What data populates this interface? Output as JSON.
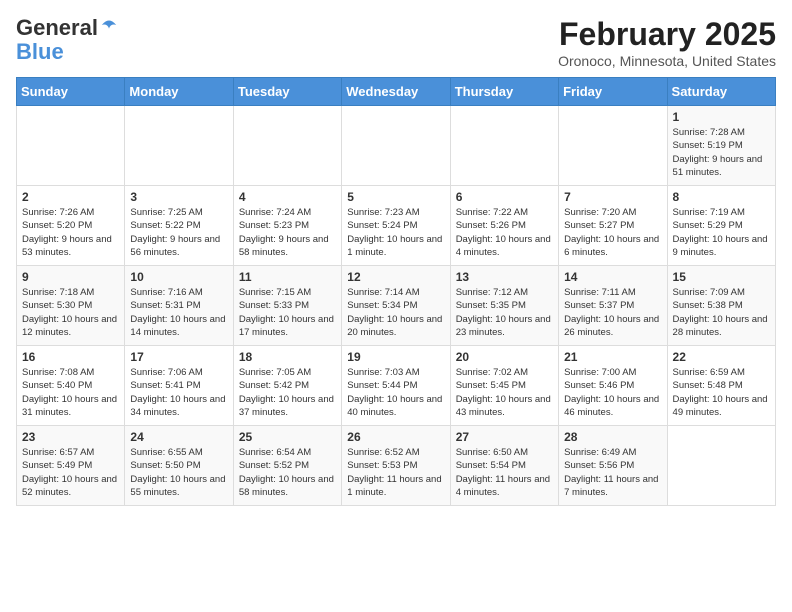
{
  "logo": {
    "line1": "General",
    "line2": "Blue"
  },
  "title": "February 2025",
  "subtitle": "Oronoco, Minnesota, United States",
  "weekdays": [
    "Sunday",
    "Monday",
    "Tuesday",
    "Wednesday",
    "Thursday",
    "Friday",
    "Saturday"
  ],
  "weeks": [
    [
      {
        "day": "",
        "info": ""
      },
      {
        "day": "",
        "info": ""
      },
      {
        "day": "",
        "info": ""
      },
      {
        "day": "",
        "info": ""
      },
      {
        "day": "",
        "info": ""
      },
      {
        "day": "",
        "info": ""
      },
      {
        "day": "1",
        "info": "Sunrise: 7:28 AM\nSunset: 5:19 PM\nDaylight: 9 hours and 51 minutes."
      }
    ],
    [
      {
        "day": "2",
        "info": "Sunrise: 7:26 AM\nSunset: 5:20 PM\nDaylight: 9 hours and 53 minutes."
      },
      {
        "day": "3",
        "info": "Sunrise: 7:25 AM\nSunset: 5:22 PM\nDaylight: 9 hours and 56 minutes."
      },
      {
        "day": "4",
        "info": "Sunrise: 7:24 AM\nSunset: 5:23 PM\nDaylight: 9 hours and 58 minutes."
      },
      {
        "day": "5",
        "info": "Sunrise: 7:23 AM\nSunset: 5:24 PM\nDaylight: 10 hours and 1 minute."
      },
      {
        "day": "6",
        "info": "Sunrise: 7:22 AM\nSunset: 5:26 PM\nDaylight: 10 hours and 4 minutes."
      },
      {
        "day": "7",
        "info": "Sunrise: 7:20 AM\nSunset: 5:27 PM\nDaylight: 10 hours and 6 minutes."
      },
      {
        "day": "8",
        "info": "Sunrise: 7:19 AM\nSunset: 5:29 PM\nDaylight: 10 hours and 9 minutes."
      }
    ],
    [
      {
        "day": "9",
        "info": "Sunrise: 7:18 AM\nSunset: 5:30 PM\nDaylight: 10 hours and 12 minutes."
      },
      {
        "day": "10",
        "info": "Sunrise: 7:16 AM\nSunset: 5:31 PM\nDaylight: 10 hours and 14 minutes."
      },
      {
        "day": "11",
        "info": "Sunrise: 7:15 AM\nSunset: 5:33 PM\nDaylight: 10 hours and 17 minutes."
      },
      {
        "day": "12",
        "info": "Sunrise: 7:14 AM\nSunset: 5:34 PM\nDaylight: 10 hours and 20 minutes."
      },
      {
        "day": "13",
        "info": "Sunrise: 7:12 AM\nSunset: 5:35 PM\nDaylight: 10 hours and 23 minutes."
      },
      {
        "day": "14",
        "info": "Sunrise: 7:11 AM\nSunset: 5:37 PM\nDaylight: 10 hours and 26 minutes."
      },
      {
        "day": "15",
        "info": "Sunrise: 7:09 AM\nSunset: 5:38 PM\nDaylight: 10 hours and 28 minutes."
      }
    ],
    [
      {
        "day": "16",
        "info": "Sunrise: 7:08 AM\nSunset: 5:40 PM\nDaylight: 10 hours and 31 minutes."
      },
      {
        "day": "17",
        "info": "Sunrise: 7:06 AM\nSunset: 5:41 PM\nDaylight: 10 hours and 34 minutes."
      },
      {
        "day": "18",
        "info": "Sunrise: 7:05 AM\nSunset: 5:42 PM\nDaylight: 10 hours and 37 minutes."
      },
      {
        "day": "19",
        "info": "Sunrise: 7:03 AM\nSunset: 5:44 PM\nDaylight: 10 hours and 40 minutes."
      },
      {
        "day": "20",
        "info": "Sunrise: 7:02 AM\nSunset: 5:45 PM\nDaylight: 10 hours and 43 minutes."
      },
      {
        "day": "21",
        "info": "Sunrise: 7:00 AM\nSunset: 5:46 PM\nDaylight: 10 hours and 46 minutes."
      },
      {
        "day": "22",
        "info": "Sunrise: 6:59 AM\nSunset: 5:48 PM\nDaylight: 10 hours and 49 minutes."
      }
    ],
    [
      {
        "day": "23",
        "info": "Sunrise: 6:57 AM\nSunset: 5:49 PM\nDaylight: 10 hours and 52 minutes."
      },
      {
        "day": "24",
        "info": "Sunrise: 6:55 AM\nSunset: 5:50 PM\nDaylight: 10 hours and 55 minutes."
      },
      {
        "day": "25",
        "info": "Sunrise: 6:54 AM\nSunset: 5:52 PM\nDaylight: 10 hours and 58 minutes."
      },
      {
        "day": "26",
        "info": "Sunrise: 6:52 AM\nSunset: 5:53 PM\nDaylight: 11 hours and 1 minute."
      },
      {
        "day": "27",
        "info": "Sunrise: 6:50 AM\nSunset: 5:54 PM\nDaylight: 11 hours and 4 minutes."
      },
      {
        "day": "28",
        "info": "Sunrise: 6:49 AM\nSunset: 5:56 PM\nDaylight: 11 hours and 7 minutes."
      },
      {
        "day": "",
        "info": ""
      }
    ]
  ]
}
